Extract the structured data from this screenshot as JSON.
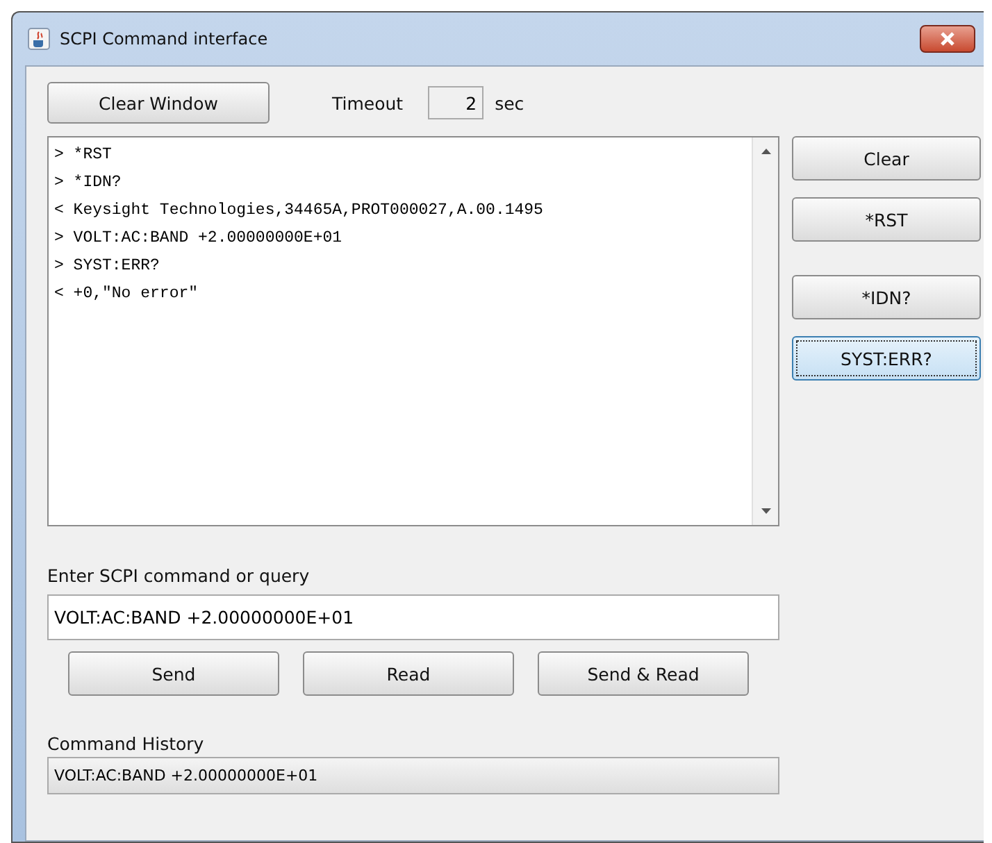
{
  "window": {
    "title": "SCPI Command interface"
  },
  "toolbar": {
    "clear_window": "Clear Window",
    "timeout_label": "Timeout",
    "timeout_value": "2",
    "timeout_unit": "sec"
  },
  "log": {
    "lines": [
      {
        "prefix": ">",
        "text": "*RST"
      },
      {
        "prefix": ">",
        "text": "*IDN?"
      },
      {
        "prefix": "<",
        "text": "Keysight Technologies,34465A,PROT000027,A.00.1495"
      },
      {
        "prefix": ">",
        "text": "VOLT:AC:BAND +2.00000000E+01"
      },
      {
        "prefix": ">",
        "text": "SYST:ERR?"
      },
      {
        "prefix": "<",
        "text": "+0,\"No error\""
      }
    ]
  },
  "side_button_groups": [
    {
      "buttons": [
        {
          "label": "Clear",
          "focused": false
        },
        {
          "label": "*RST",
          "focused": false
        }
      ]
    },
    {
      "buttons": [
        {
          "label": "*IDN?",
          "focused": false
        },
        {
          "label": "SYST:ERR?",
          "focused": true
        }
      ]
    }
  ],
  "command": {
    "label": "Enter SCPI command or query",
    "value": "VOLT:AC:BAND +2.00000000E+01"
  },
  "action_buttons": [
    "Send",
    "Read",
    "Send & Read"
  ],
  "history": {
    "label": "Command History",
    "value": "VOLT:AC:BAND +2.00000000E+01"
  }
}
